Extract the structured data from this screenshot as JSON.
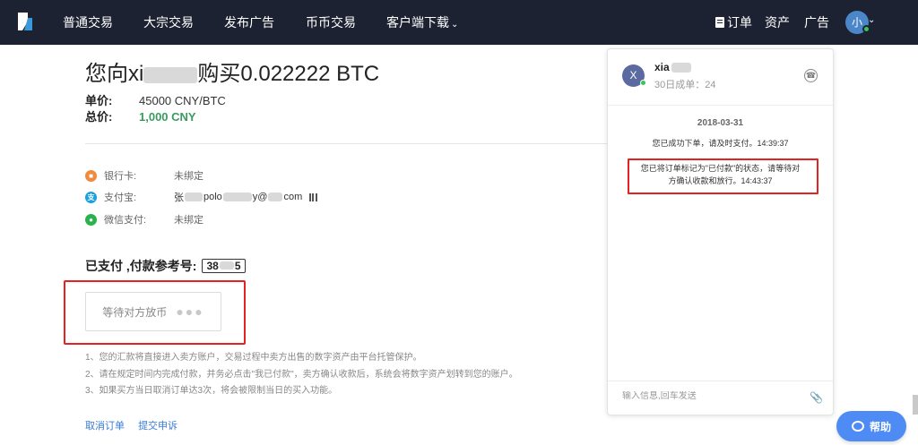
{
  "nav": {
    "items": [
      "普通交易",
      "大宗交易",
      "发布广告",
      "币币交易",
      "客户端下载"
    ],
    "orders": "订单",
    "assets": "资产",
    "ads": "广告",
    "avatar_initial": "小"
  },
  "order": {
    "title_prefix": "您向xi",
    "title_suffix": "购买0.022222 BTC",
    "unit_price_label": "单价:",
    "unit_price": "45000 CNY/BTC",
    "total_label": "总价:",
    "total": "1,000 CNY"
  },
  "payment_methods": [
    {
      "label": "银行卡:",
      "value": "未绑定",
      "icon": "bank-card-icon",
      "color": "#f08a3c"
    },
    {
      "label": "支付宝:",
      "value_prefix": "张",
      "value_middle": "polo",
      "value_suffix": "y@",
      "value_end": "com",
      "icon": "alipay-icon",
      "color": "#1a9fe0"
    },
    {
      "label": "微信支付:",
      "value": "未绑定",
      "icon": "wechat-icon",
      "color": "#2bb24c"
    }
  ],
  "paid": {
    "label": "已支付 ,付款参考号:",
    "ref_prefix": "38",
    "ref_suffix": "5"
  },
  "wait_button": "等待对方放币",
  "notes": [
    "1、您的汇款将直接进入卖方账户，交易过程中卖方出售的数字资产由平台托管保护。",
    "2、请在规定时间内完成付款，并务必点击\"我已付款\"，卖方确认收款后，系统会将数字资产划转到您的账户。",
    "3、如果买方当日取消订单达3次，将会被限制当日的买入功能。"
  ],
  "links": {
    "cancel": "取消订单",
    "appeal": "提交申诉"
  },
  "chat": {
    "avatar_initial": "X",
    "name": "xia",
    "orders_30d": "30日成单：24",
    "date": "2018-03-31",
    "msg1": "您已成功下单，请及时支付。14:39:37",
    "msg2_line1": "您已将订单标记为\"已付款\"的状态，请等待对",
    "msg2_line2": "方确认收款和放行。14:43:37",
    "input_placeholder": "输入信息,回车发送"
  },
  "help": "帮助",
  "colors": {
    "nav_bg": "#1d2232",
    "accent": "#4e8bf5",
    "green": "#3c9a5f",
    "highlight": "#e52222"
  }
}
